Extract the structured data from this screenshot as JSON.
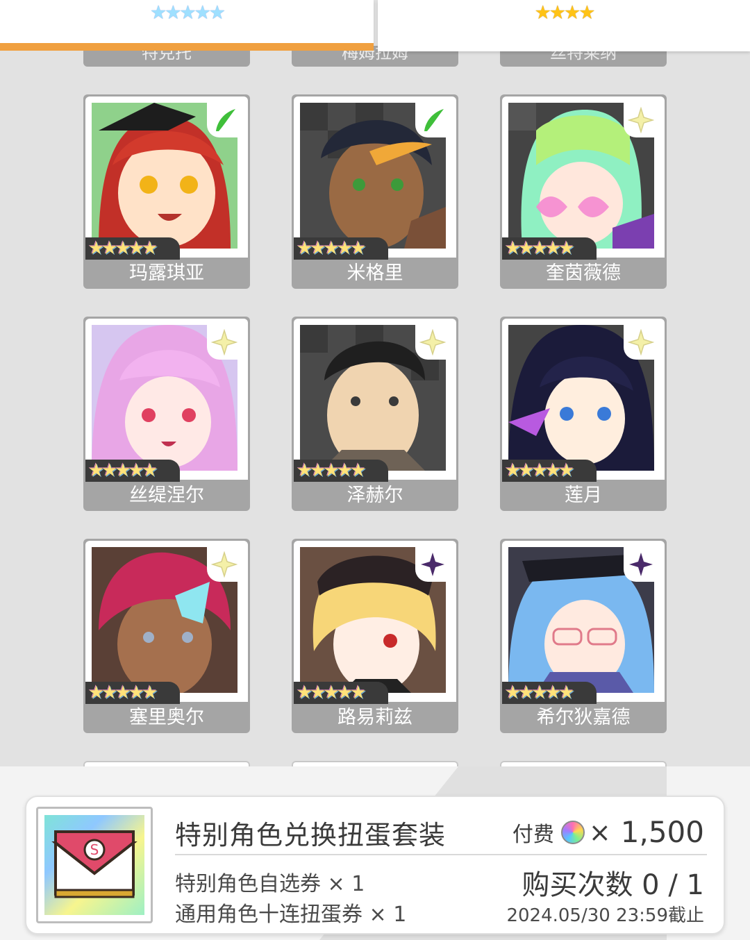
{
  "tabs": [
    {
      "stars": "★★★★★",
      "style": "rainbow",
      "selected": true
    },
    {
      "stars": "★★★★",
      "style": "gold",
      "selected": false
    }
  ],
  "colors": {
    "accent": "#f0a040",
    "card_frame": "#a5a5a5",
    "background": "#e2e2e2"
  },
  "partial_top_names": [
    "特克托",
    "梅姆拉姆",
    "丝特莱纳"
  ],
  "characters": [
    {
      "name": "玛露琪亚",
      "stars": "★★★★★",
      "element": "wind"
    },
    {
      "name": "米格里",
      "stars": "★★★★★",
      "element": "wind"
    },
    {
      "name": "奎茵薇德",
      "stars": "★★★★★",
      "element": "light"
    },
    {
      "name": "丝缇涅尔",
      "stars": "★★★★★",
      "element": "light"
    },
    {
      "name": "泽赫尔",
      "stars": "★★★★★",
      "element": "light"
    },
    {
      "name": "莲月",
      "stars": "★★★★★",
      "element": "light"
    },
    {
      "name": "塞里奥尔",
      "stars": "★★★★★",
      "element": "light"
    },
    {
      "name": "路易莉兹",
      "stars": "★★★★★",
      "element": "dark"
    },
    {
      "name": "希尔狄嘉德",
      "stars": "★★★★★",
      "element": "dark"
    }
  ],
  "item": {
    "title": "特别角色兑换扭蛋套装",
    "line1": "特别角色自选券 × 1",
    "line2": "通用角色十连扭蛋券 × 1",
    "price_label": "付费",
    "price_mult": "×",
    "price_value": "1,500",
    "buy_count": "购买次数 0 / 1",
    "deadline": "2024.05/30 23:59截止",
    "icon": "envelope-icon"
  }
}
